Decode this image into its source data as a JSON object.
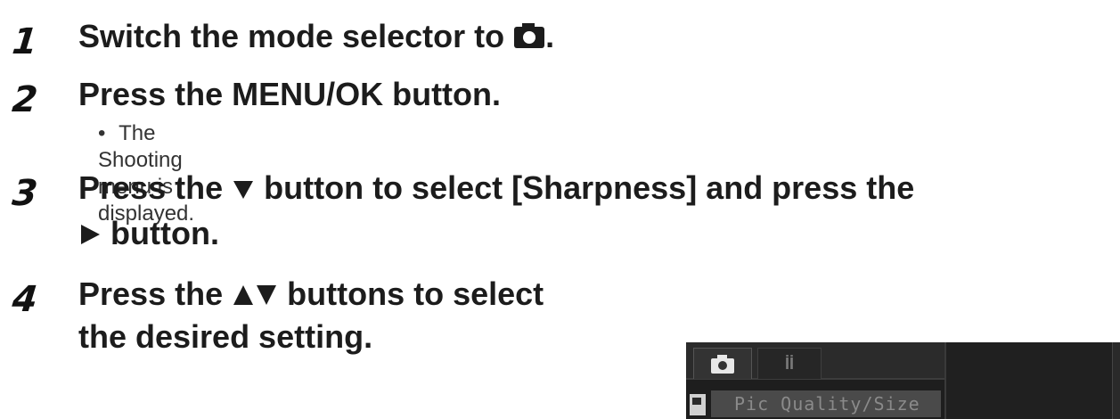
{
  "steps": [
    {
      "number": "1",
      "title_before": "Switch the mode selector to",
      "title_after": "."
    },
    {
      "number": "2",
      "title": "Press the MENU/OK button.",
      "bullet": "The Shooting menu is displayed."
    },
    {
      "number": "3",
      "line1_before": "Press the",
      "line1_after": "button to select [Sharpness] and press the",
      "line2_after": "button."
    },
    {
      "number": "4",
      "line1_before": "Press the",
      "line1_after": "buttons to select",
      "line2": "the desired setting."
    }
  ],
  "bullet_mark": "•",
  "screen": {
    "tab_setup_glyph": "İİ",
    "menu_item": "Pic Quality/Size"
  },
  "icons": {
    "mode": "camera-icon",
    "down": "down-triangle-icon",
    "right": "right-triangle-icon",
    "updown": "up-down-triangle-icon"
  }
}
